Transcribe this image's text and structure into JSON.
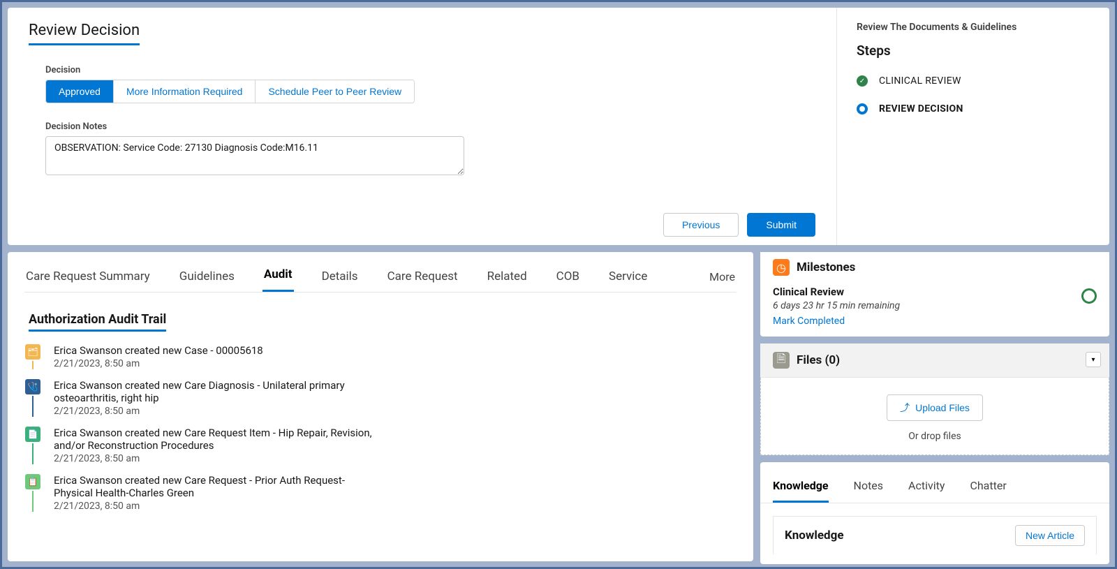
{
  "header": {
    "title": "Review Decision"
  },
  "decision": {
    "label": "Decision",
    "options": [
      "Approved",
      "More Information Required",
      "Schedule Peer to Peer Review"
    ],
    "notes_label": "Decision Notes",
    "notes_value": "OBSERVATION: Service Code: 27130 Diagnosis Code:M16.11",
    "previous_label": "Previous",
    "submit_label": "Submit"
  },
  "steps_panel": {
    "title": "Review The Documents & Guidelines",
    "heading": "Steps",
    "items": [
      {
        "label": "CLINICAL REVIEW",
        "status": "done"
      },
      {
        "label": "REVIEW DECISION",
        "status": "current"
      }
    ]
  },
  "tabs": {
    "items": [
      "Care Request Summary",
      "Guidelines",
      "Audit",
      "Details",
      "Care Request",
      "Related",
      "COB",
      "Service"
    ],
    "more": "More",
    "active": "Audit"
  },
  "audit": {
    "title": "Authorization Audit Trail",
    "items": [
      {
        "icon_color": "#f2b751",
        "line_color": "#f2b751",
        "text": "Erica Swanson created new Case - 00005618",
        "time": "2/21/2023, 8:50 am"
      },
      {
        "icon_color": "#2f5f92",
        "line_color": "#2f5f92",
        "text": "Erica Swanson created new Care Diagnosis - Unilateral primary osteoarthritis, right hip",
        "time": "2/21/2023, 8:50 am"
      },
      {
        "icon_color": "#3bb07a",
        "line_color": "#3bb07a",
        "text": "Erica Swanson created new Care Request Item - Hip Repair, Revision, and/or Reconstruction Procedures",
        "time": "2/21/2023, 8:50 am"
      },
      {
        "icon_color": "#6fc97a",
        "line_color": "#6fc97a",
        "text": "Erica Swanson created new Care Request - Prior Auth Request-Physical Health-Charles Green",
        "time": "2/21/2023, 8:50 am"
      }
    ]
  },
  "milestones": {
    "title": "Milestones",
    "name": "Clinical Review",
    "remaining": "6 days 23 hr 15 min remaining",
    "mark": "Mark Completed"
  },
  "files": {
    "title": "Files (0)",
    "upload": "Upload Files",
    "drop": "Or drop files"
  },
  "knowledge": {
    "tabs": [
      "Knowledge",
      "Notes",
      "Activity",
      "Chatter"
    ],
    "sub_title": "Knowledge",
    "new_article": "New Article"
  }
}
